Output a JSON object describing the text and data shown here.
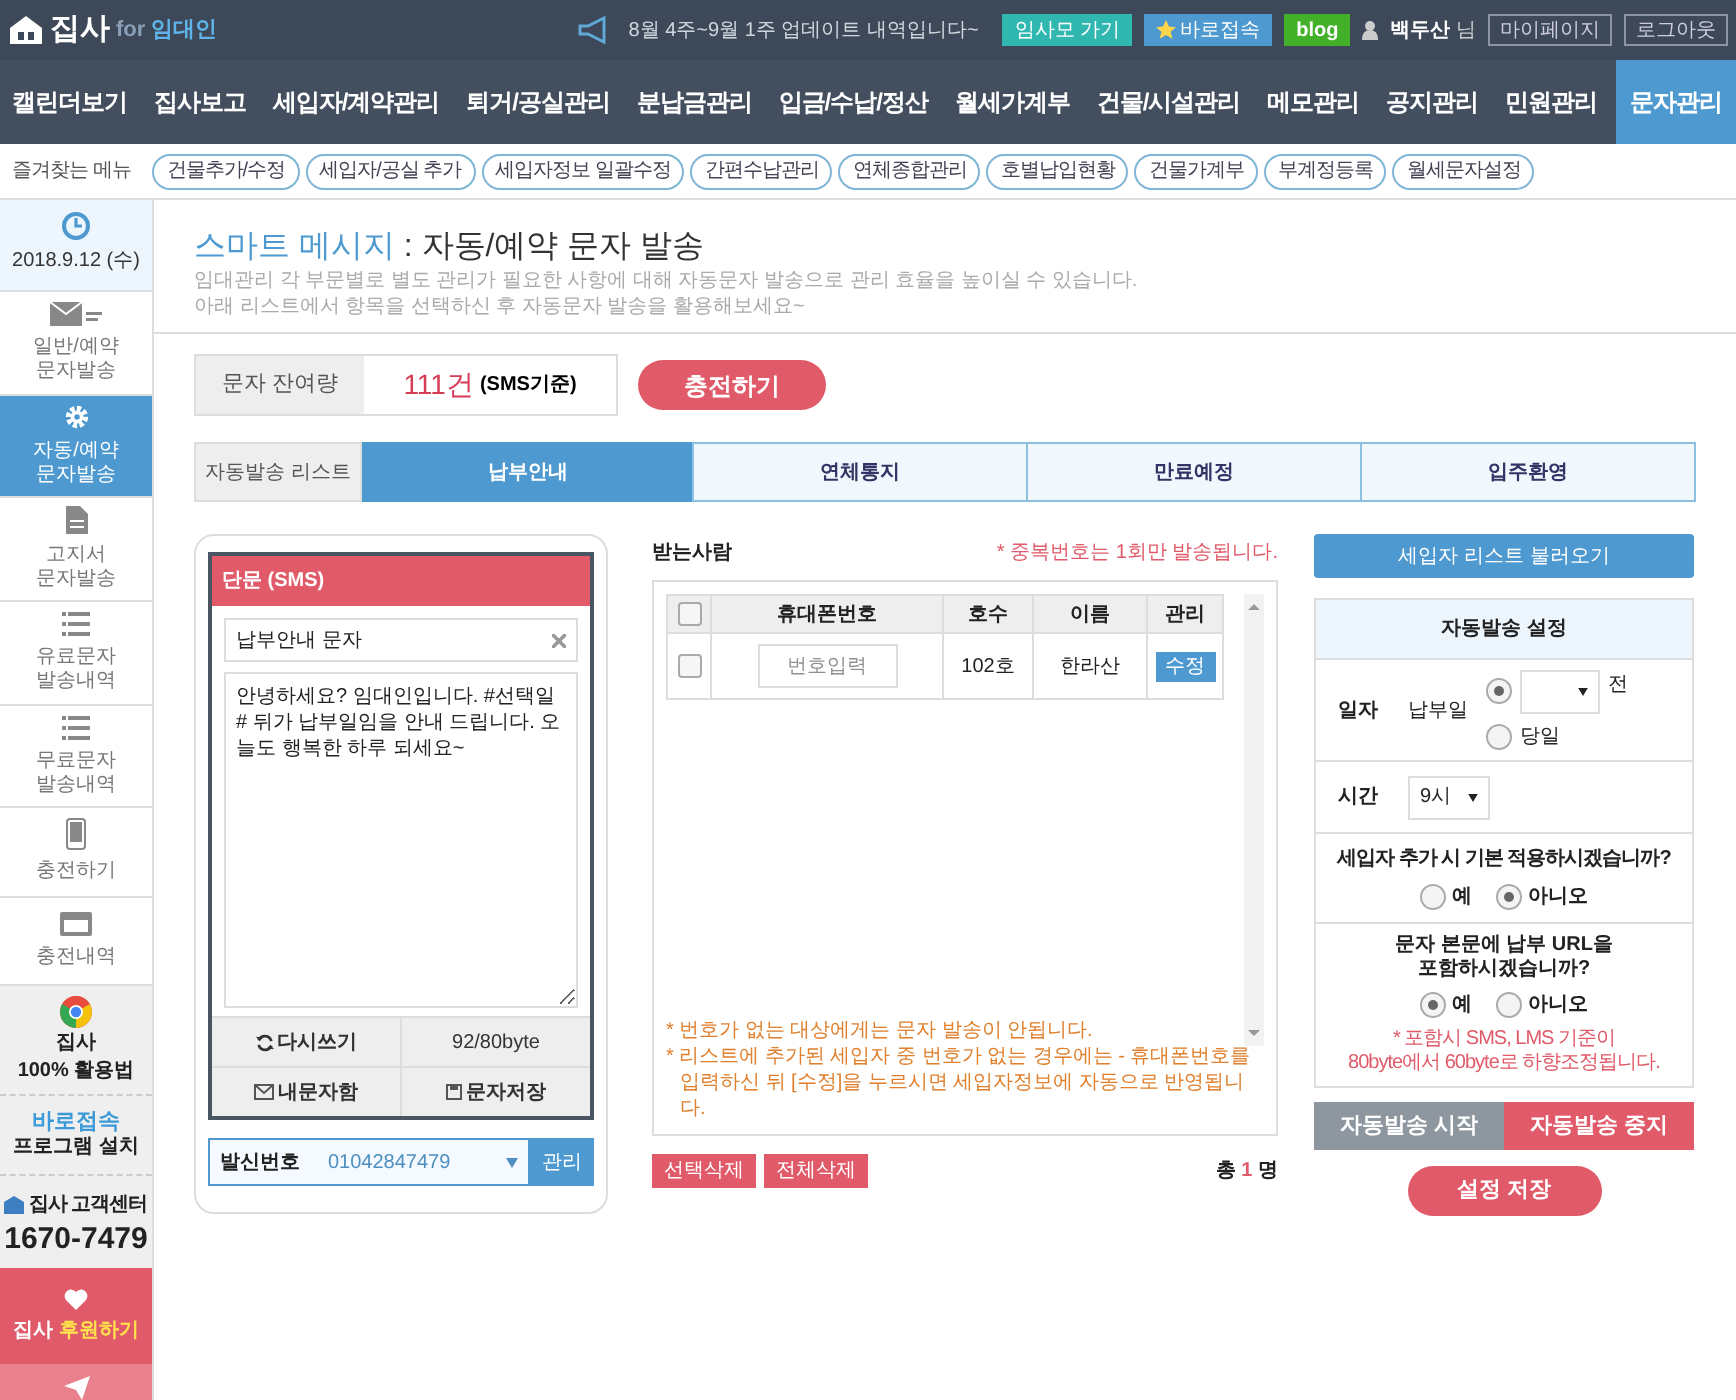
{
  "header": {
    "brand": "집사",
    "brand_for": "for",
    "brand_sub": "임대인",
    "notice": "8월 4주~9월 1주 업데이트 내역입니다~",
    "buttons": [
      {
        "label": "임사모 가기",
        "kind": "teal"
      },
      {
        "label": "바로접속",
        "kind": "star"
      },
      {
        "label": "blog",
        "kind": "blog"
      }
    ],
    "user_name": "백두산",
    "user_suffix": "님",
    "links": [
      "마이페이지",
      "로그아웃"
    ]
  },
  "nav": [
    {
      "label": "캘린더보기",
      "selected": false
    },
    {
      "label": "집사보고",
      "selected": false
    },
    {
      "label": "세입자/계약관리",
      "selected": false
    },
    {
      "label": "퇴거/공실관리",
      "selected": false
    },
    {
      "label": "분납금관리",
      "selected": false
    },
    {
      "label": "입금/수납/정산",
      "selected": false
    },
    {
      "label": "월세가계부",
      "selected": false
    },
    {
      "label": "건물/시설관리",
      "selected": false
    },
    {
      "label": "메모관리",
      "selected": false
    },
    {
      "label": "공지관리",
      "selected": false
    },
    {
      "label": "민원관리",
      "selected": false
    },
    {
      "label": "문자관리",
      "selected": true
    }
  ],
  "favorites": {
    "label": "즐겨찾는 메뉴",
    "items": [
      "건물추가/수정",
      "세입자/공실 추가",
      "세입자정보 일괄수정",
      "간편수납관리",
      "연체종합관리",
      "호별납입현황",
      "건물가계부",
      "부계정등록",
      "월세문자설정"
    ]
  },
  "sidebar": {
    "date": "2018.9.12 (수)",
    "items": [
      {
        "kind": "mail",
        "lines": [
          "일반/예약",
          "문자발송"
        ],
        "selected": false
      },
      {
        "kind": "gear",
        "lines": [
          "자동/예약",
          "문자발송"
        ],
        "selected": true
      },
      {
        "kind": "document",
        "lines": [
          "고지서",
          "문자발송"
        ],
        "selected": false
      },
      {
        "kind": "list",
        "lines": [
          "유료문자",
          "발송내역"
        ],
        "selected": false
      },
      {
        "kind": "list",
        "lines": [
          "무료문자",
          "발송내역"
        ],
        "selected": false
      },
      {
        "kind": "phone",
        "lines": [
          "충전하기"
        ],
        "selected": false
      },
      {
        "kind": "card",
        "lines": [
          "충전내역"
        ],
        "selected": false
      }
    ],
    "promos": [
      {
        "kind": "guide",
        "lines": [
          "집사",
          "100% 활용법"
        ]
      },
      {
        "kind": "install",
        "lines": [
          "바로접속",
          "프로그램 설치"
        ]
      },
      {
        "kind": "support",
        "lines": [
          "집사 고객센터",
          "1670-7479"
        ]
      },
      {
        "kind": "donate",
        "lines": [
          "집사",
          "후원하기"
        ]
      },
      {
        "kind": "send"
      }
    ]
  },
  "page": {
    "title_prefix": "스마트 메시지",
    "title": ": 자동/예약 문자 발송",
    "description": [
      "임대관리 각 부문별로 별도 관리가 필요한 사항에 대해 자동문자 발송으로 관리 효율을 높이실 수 있습니다.",
      "아래 리스트에서 항목을 선택하신 후 자동문자 발송을 활용해보세요~"
    ]
  },
  "balance": {
    "label": "문자 잔여량",
    "count": "111건",
    "unit": "(SMS기준)",
    "charge_button": "충전하기"
  },
  "tabs": {
    "label": "자동발송 리스트",
    "items": [
      {
        "label": "납부안내",
        "selected": true
      },
      {
        "label": "연체통지",
        "selected": false
      },
      {
        "label": "만료예정",
        "selected": false
      },
      {
        "label": "입주환영",
        "selected": false
      }
    ]
  },
  "sms": {
    "header": "단문 (SMS)",
    "subject": "납부안내 문자",
    "body": "안녕하세요? 임대인입니다. #선택일# 뒤가 납부일임을 안내 드립니다. 오늘도 행복한 하루 되세요~",
    "rewrite": "다시쓰기",
    "bytes": "92/80byte",
    "inbox": "내문자함",
    "save": "문자저장",
    "sender_label": "발신번호",
    "sender_value": "01042847479",
    "manage": "관리"
  },
  "recipients": {
    "title": "받는사람",
    "note": "* 중복번호는 1회만 발송됩니다.",
    "all_checked": false,
    "columns": [
      "휴대폰번호",
      "호수",
      "이름",
      "관리"
    ],
    "rows": [
      {
        "checked": false,
        "phone_placeholder": "번호입력",
        "unit": "102호",
        "name": "한라산",
        "action": "수정"
      }
    ],
    "notes": [
      "* 번호가 없는 대상에게는 문자 발송이 안됩니다.",
      "* 리스트에 추가된 세입자 중 번호가 없는 경우에는 - 휴대폰번호를 입력하신 뒤 [수정]을 누르시면 세입자정보에 자동으로 반영됩니다."
    ],
    "buttons": [
      "선택삭제",
      "전체삭제"
    ],
    "total_prefix": "총",
    "total_count": "1",
    "total_suffix": "명"
  },
  "settings": {
    "load_button": "세입자 리스트 불러오기",
    "title": "자동발송 설정",
    "date_label": "일자",
    "date_sub": "납부일",
    "date_options": [
      {
        "kind": "select",
        "suffix": "전",
        "selected": true
      },
      {
        "kind": "plain",
        "label": "당일",
        "selected": false
      }
    ],
    "time_label": "시간",
    "time_value": "9시",
    "q1": "세입자 추가 시 기본 적용하시겠습니까?",
    "q1_options": [
      {
        "label": "예",
        "selected": false
      },
      {
        "label": "아니오",
        "selected": true
      }
    ],
    "q2": [
      "문자 본문에 납부 URL을",
      "포함하시겠습니까?"
    ],
    "q2_options": [
      {
        "label": "예",
        "selected": true
      },
      {
        "label": "아니오",
        "selected": false
      }
    ],
    "q2_note": [
      "* 포함시 SMS, LMS 기준이",
      "80byte에서 60byte로 하향조정됩니다."
    ],
    "actions": [
      {
        "label": "자동발송 시작",
        "kind": "start"
      },
      {
        "label": "자동발송 중지",
        "kind": "stop"
      }
    ],
    "save_button": "설정 저장"
  }
}
